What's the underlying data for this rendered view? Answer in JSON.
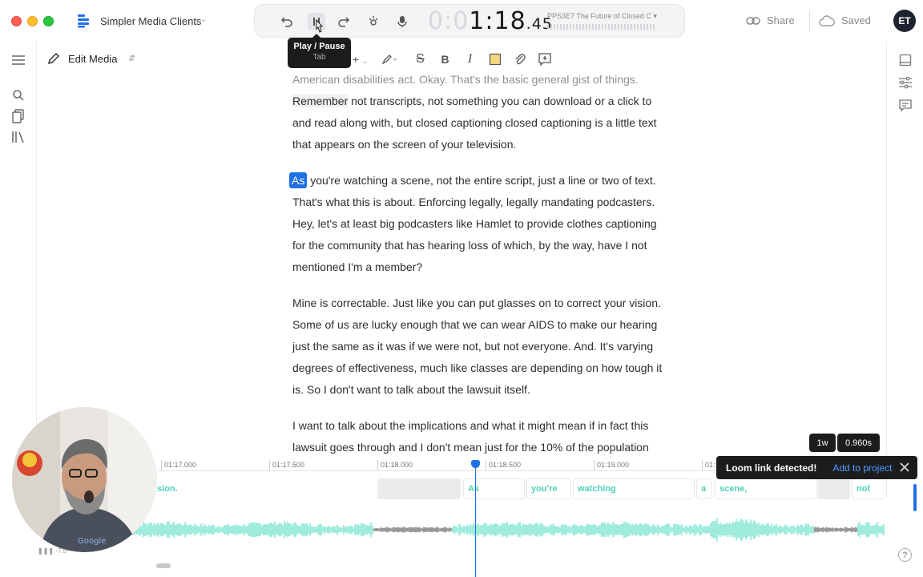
{
  "window": {
    "project_name": "Simpler Media Clients"
  },
  "transport": {
    "timecode_dim": "0:0",
    "timecode_main": "1:18",
    "timecode_frac": ".45",
    "doc_title": "PPS3E7 The Future of Closed C"
  },
  "topbar": {
    "share_label": "Share",
    "saved_label": "Saved",
    "avatar_initials": "ET"
  },
  "tooltip": {
    "title": "Play / Pause",
    "shortcut": "Tab"
  },
  "editor": {
    "mode_label": "Edit Media"
  },
  "transcript": {
    "p1": {
      "line1": "American disabilities act. Okay. That's the basic general gist of things.",
      "line2_hl": "Remember",
      "line2_rest": " not transcripts, not something you can download or a click to",
      "line3": "and read along with, but closed captioning closed captioning is a little text",
      "line4": "that appears on the screen of your television."
    },
    "p2": {
      "active_word": "As",
      "line1_rest": " you're watching a scene, not the entire script, just a line or two of text.",
      "line2": "That's what this is about. Enforcing legally, legally mandating podcasters.",
      "line3": "Hey, let's at least big podcasters like Hamlet to provide clothes captioning",
      "line4": "for the community that has hearing loss of which, by the way, have I not",
      "line5": "mentioned I'm a member?"
    },
    "p3": {
      "line1": "Mine is correctable. Just like you can put glasses on to correct your vision.",
      "line2": "Some of us are lucky enough that we can wear AIDS to make our hearing",
      "line3": "just the same as it was if we were not, but not everyone. And. It's varying",
      "line4": "degrees of effectiveness, much like classes are depending on how tough it",
      "line5": "is. So I don't want to talk about the lawsuit itself."
    },
    "p4": {
      "line1": "I want to talk about the implications and what it might mean if in fact this",
      "line2": "lawsuit goes through and I don't mean just for the 10% of the population"
    }
  },
  "speed_chip": {
    "gap": "1w",
    "duration": "0.960s"
  },
  "toast": {
    "message": "Loom link detected!",
    "action": "Add to project"
  },
  "timeline": {
    "ticks": [
      "01:17.000",
      "01:17.500",
      "01:18.000",
      "01:18.500",
      "01:19.000",
      "01:"
    ],
    "words": [
      "sion.",
      "As",
      "you're",
      "watching",
      "a",
      "scene,",
      "not"
    ],
    "gain_label": "-7.5",
    "playhead_time": "01:18.45"
  },
  "colors": {
    "accent": "#1f6fe5",
    "waveform": "#5fe0c4",
    "word_text": "#4fd1b7",
    "dark": "#1c1c1e"
  }
}
